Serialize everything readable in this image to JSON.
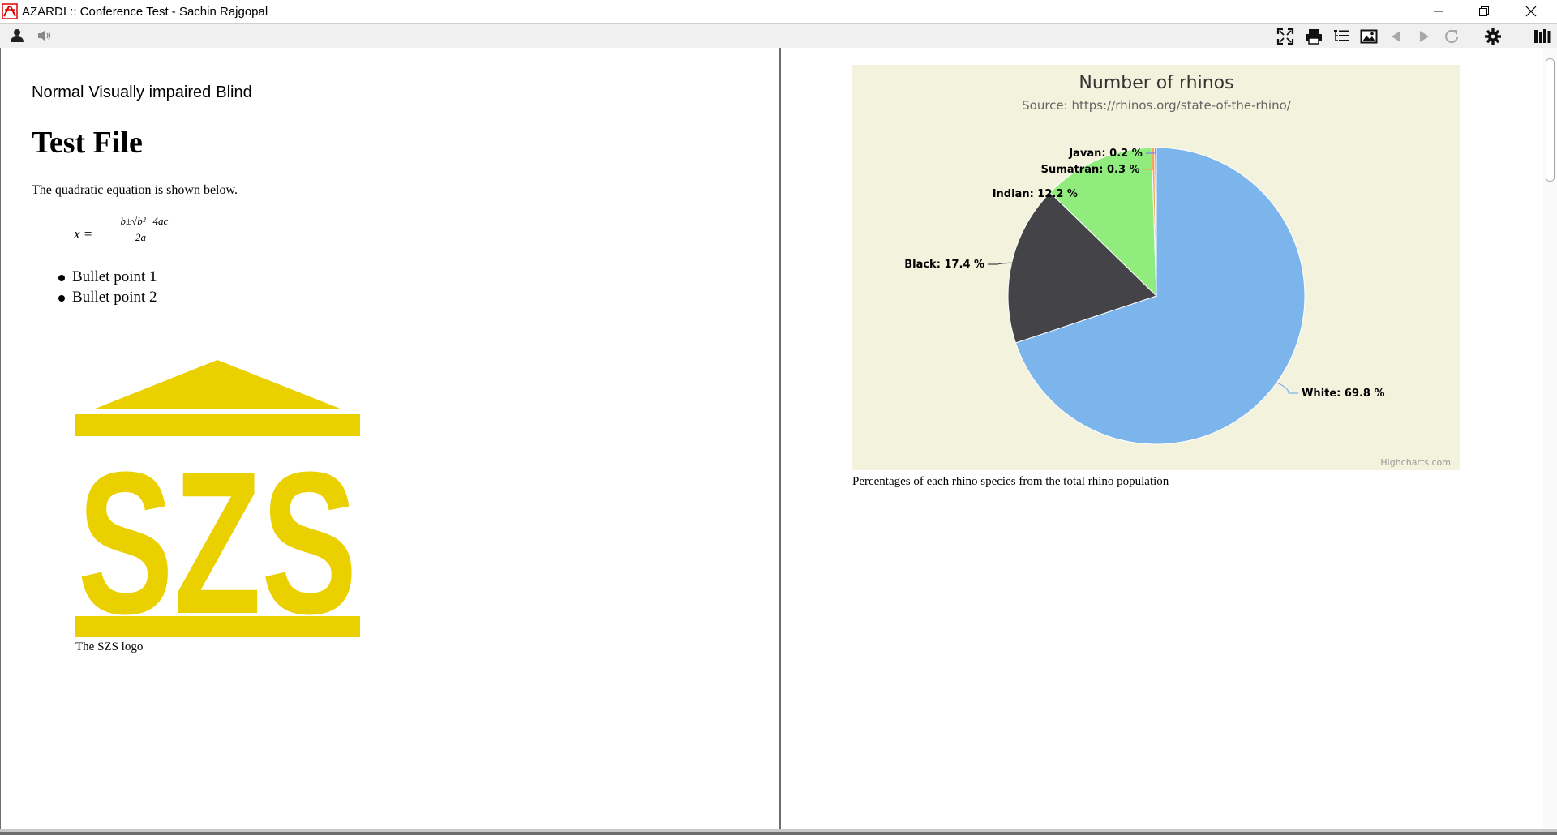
{
  "window": {
    "title": "AZARDI :: Conference Test - Sachin Rajgopal",
    "controls": [
      "minimize",
      "restore",
      "close"
    ]
  },
  "toolbar": {
    "left_icons": [
      "user-icon",
      "speaker-icon"
    ],
    "right_icons": [
      "fullscreen-icon",
      "print-icon",
      "toc-icon",
      "image-icon",
      "back-arrow-icon",
      "forward-arrow-icon",
      "refresh-icon",
      "settings-gear-icon",
      "library-icon"
    ]
  },
  "document": {
    "modes": [
      "Normal",
      "Visually impaired",
      "Blind"
    ],
    "title": "Test File",
    "intro": "The quadratic equation is shown below.",
    "formula": {
      "lhs": "x =",
      "numerator": "−b±√b²−4ac",
      "denominator": "2a"
    },
    "bullets": [
      "Bullet point 1",
      "Bullet point 2"
    ],
    "logo": {
      "text": "SZS",
      "color": "#EBD000"
    },
    "logo_caption": "The SZS logo",
    "chart_caption": "Percentages of each rhino species from the total rhino population"
  },
  "chart_data": {
    "type": "pie",
    "title": "Number of rhinos",
    "subtitle": "Source: https://rhinos.org/state-of-the-rhino/",
    "background": "#F3F2DC",
    "credits": "Highcharts.com",
    "slices": [
      {
        "name": "White",
        "value": 69.8,
        "label": "White: 69.8 %",
        "color": "#7CB5EC"
      },
      {
        "name": "Black",
        "value": 17.4,
        "label": "Black: 17.4 %",
        "color": "#434348"
      },
      {
        "name": "Indian",
        "value": 12.2,
        "label": "Indian: 12.2 %",
        "color": "#90ED7D"
      },
      {
        "name": "Sumatran",
        "value": 0.3,
        "label": "Sumatran: 0.3 %",
        "color": "#F7A35C"
      },
      {
        "name": "Javan",
        "value": 0.2,
        "label": "Javan: 0.2 %",
        "color": "#8085E9"
      }
    ]
  }
}
